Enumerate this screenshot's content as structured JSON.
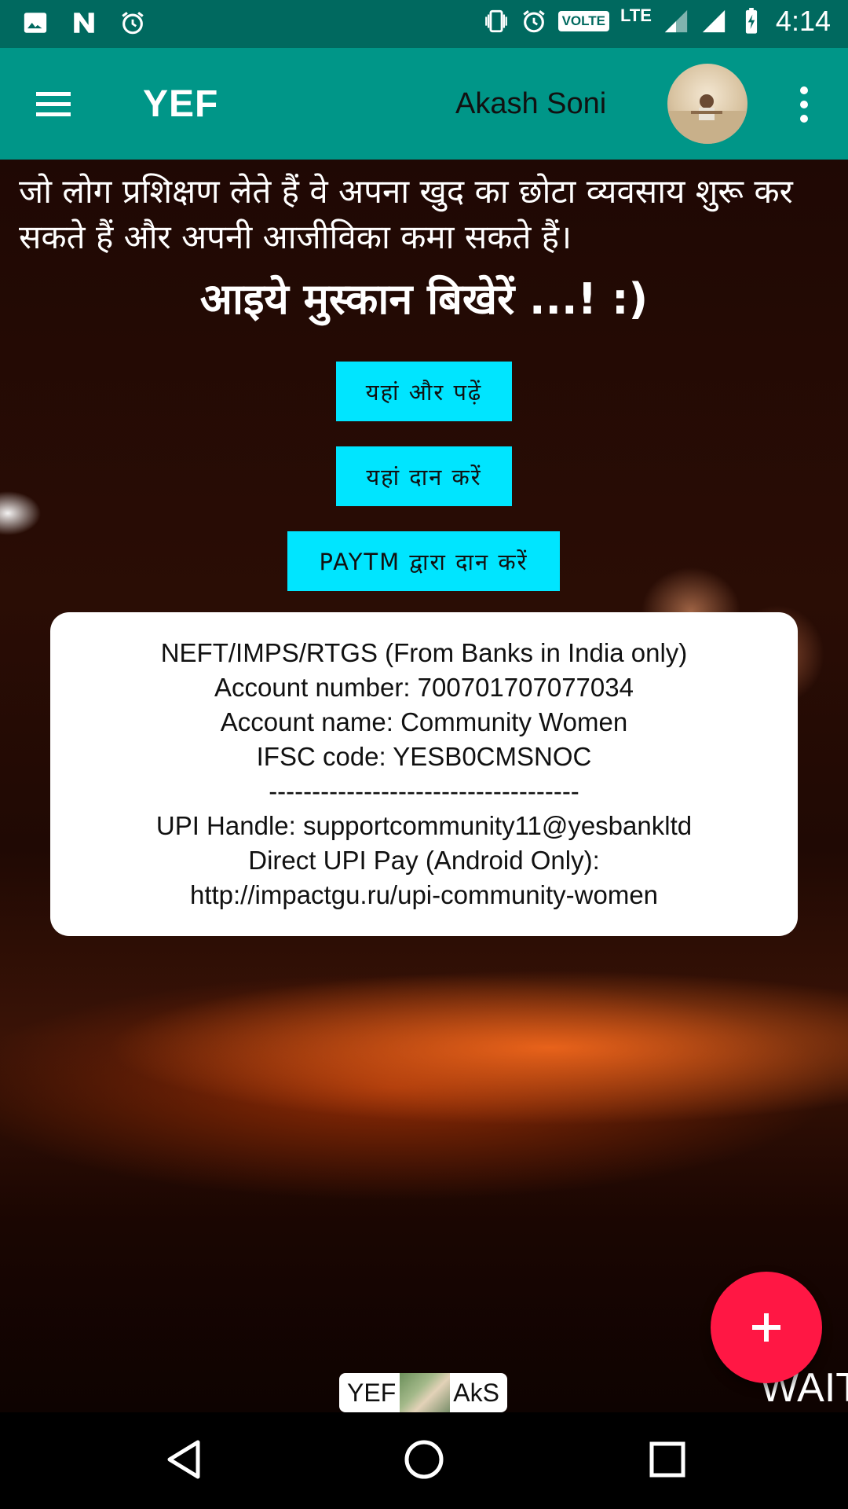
{
  "status_bar": {
    "time": "4:14",
    "volte": "VOLTE",
    "network": "LTE",
    "left_icons": [
      "image-icon",
      "n-notification-icon",
      "alarm-icon"
    ],
    "right_icons": [
      "vibrate-icon",
      "alarm-icon",
      "signal-icon",
      "signal-icon",
      "battery-charging-icon"
    ]
  },
  "toolbar": {
    "title": "YEF",
    "user_name": "Akash Soni",
    "menu_icon": "hamburger-menu-icon",
    "more_icon": "more-vertical-icon"
  },
  "hero": {
    "text": "जो लोग प्रशिक्षण लेते हैं वे अपना खुद का छोटा व्यवसाय शुरू कर सकते हैं और अपनी आजीविका कमा सकते हैं।",
    "slogan": "आइये मुस्कान बिखेरें ...! :)"
  },
  "buttons": {
    "read_more": "यहां और पढ़ें",
    "donate": "यहां दान करें",
    "paytm": "PAYTM द्वारा दान करें"
  },
  "bank_info": {
    "line1": "NEFT/IMPS/RTGS (From Banks in India only)",
    "line2": "Account number: 700701707077034",
    "line3": "Account name: Community Women",
    "line4": "IFSC code: YESB0CMSNOC",
    "divider": "------------------------------------",
    "line5": "UPI Handle: supportcommunity11@yesbankltd",
    "line6": "Direct UPI Pay (Android Only):",
    "line7": "http://impactgu.ru/upi-community-women"
  },
  "fab": {
    "icon": "plus-icon",
    "color": "#ff1744"
  },
  "footer": {
    "left_label": "YEF",
    "right_label": "AkS",
    "wait_text": "WAIT"
  },
  "colors": {
    "status_bar": "#00695f",
    "toolbar": "#009688",
    "button": "#00e5ff"
  },
  "nav": {
    "icons": [
      "back-icon",
      "home-icon",
      "recents-icon"
    ]
  }
}
